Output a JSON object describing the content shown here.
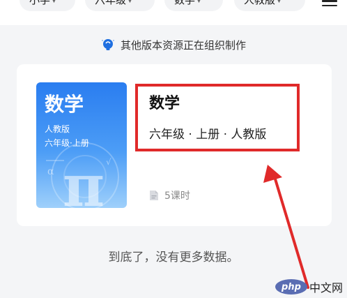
{
  "filters": {
    "items": [
      {
        "label": "小学"
      },
      {
        "label": "六年级"
      },
      {
        "label": "数学"
      },
      {
        "label": "人教版"
      }
    ],
    "caret_icon": "chevron-down-icon",
    "menu_icon": "menu-icon"
  },
  "notice": {
    "icon": "lightbulb-icon",
    "text": "其他版本资源正在组织制作"
  },
  "book": {
    "cover": {
      "title": "数学",
      "publisher": "人教版",
      "grade": "六年级·上册",
      "symbol": "π"
    },
    "title": "数学",
    "subtitle": "六年级 · 上册 · 人教版",
    "lessons_icon": "document-icon",
    "lessons": "5课时"
  },
  "footer": {
    "end_text": "到底了，没有更多数据。"
  },
  "watermark": {
    "logo": "php",
    "text": "中文网"
  },
  "colors": {
    "highlight": "#e02a2a",
    "accent_blue": "#2a7df0"
  }
}
